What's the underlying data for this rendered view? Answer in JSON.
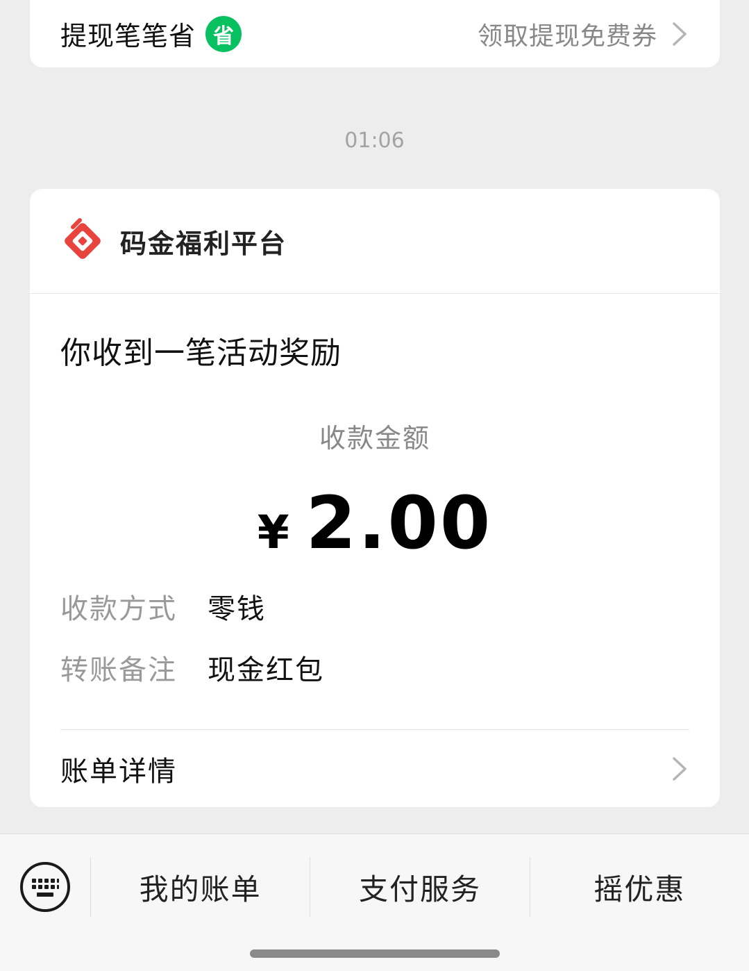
{
  "top_card": {
    "title": "提现笔笔省",
    "badge": "省",
    "link_label": "领取提现免费券"
  },
  "timestamp": "01:06",
  "message": {
    "brand_name": "码金福利平台",
    "title": "你收到一笔活动奖励",
    "amount_label": "收款金额",
    "currency": "¥",
    "amount": "2.00",
    "details": [
      {
        "key": "收款方式",
        "value": "零钱"
      },
      {
        "key": "转账备注",
        "value": "现金红包"
      }
    ],
    "bill_label": "账单详情"
  },
  "bottom_menu": {
    "items": [
      {
        "label": "我的账单"
      },
      {
        "label": "支付服务"
      },
      {
        "label": "摇优惠"
      }
    ]
  },
  "colors": {
    "accent_green": "#07c160",
    "brand_red": "#e8433c",
    "background": "#ededed"
  }
}
